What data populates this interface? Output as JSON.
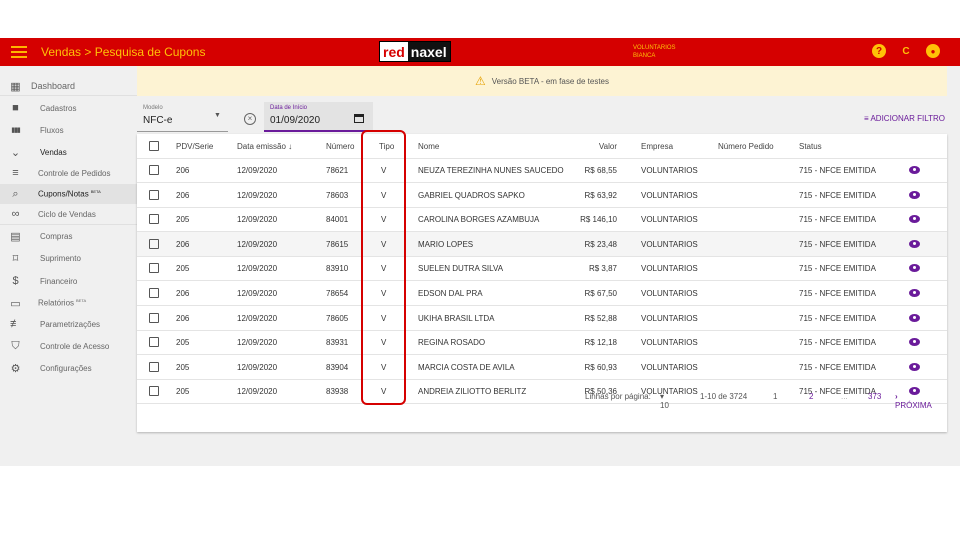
{
  "header": {
    "title": "Vendas > Pesquisa de Cupons",
    "logo_red": "red",
    "logo_dark": "naxel",
    "company_line1": "VOLUNTARIOS",
    "company_line2": "BIANCA",
    "help_icon": "?",
    "refresh_icon": "C",
    "user_icon": "●",
    "colors": {
      "bar": "#d50000",
      "accent": "#ffc107",
      "primary": "#6a1b9a"
    }
  },
  "sidebar": {
    "items": [
      {
        "label": "Dashboard",
        "icon": "dashboard-icon",
        "glyph": "▦"
      },
      {
        "label": "Cadastros",
        "icon": "folder-icon",
        "glyph": "■"
      },
      {
        "label": "Fluxos",
        "icon": "flow-icon",
        "glyph": "▮▮▮"
      },
      {
        "label": "Vendas",
        "icon": "chevron-down-icon",
        "glyph": "⌄"
      },
      {
        "label": "Controle de Pedidos",
        "icon": "list-icon",
        "glyph": "≡"
      },
      {
        "label": "Cupons/Notas",
        "badge": "BETA",
        "icon": "search-icon",
        "glyph": "⌕"
      },
      {
        "label": "Ciclo de Vendas",
        "icon": "infinity-icon",
        "glyph": "∞"
      },
      {
        "label": "Compras",
        "icon": "building-icon",
        "glyph": "▤"
      },
      {
        "label": "Suprimento",
        "icon": "supply-icon",
        "glyph": "⌑"
      },
      {
        "label": "Financeiro",
        "icon": "money-icon",
        "glyph": "$"
      },
      {
        "label": "Relatórios",
        "badge": "BETA",
        "icon": "print-icon",
        "glyph": "▭"
      },
      {
        "label": "Parametrizações",
        "icon": "sliders-icon",
        "glyph": "≢"
      },
      {
        "label": "Controle de Acesso",
        "icon": "shield-icon",
        "glyph": "⛉"
      },
      {
        "label": "Configurações",
        "icon": "gear-icon",
        "glyph": "⚙"
      }
    ]
  },
  "banner": {
    "text": "Versão BETA - em fase de testes",
    "icon": "warning-icon"
  },
  "filters": {
    "model_label": "Modelo",
    "model_value": "NFC-e",
    "date_label": "Data de Início",
    "date_value": "01/09/2020",
    "add_filter": "ADICIONAR FILTRO"
  },
  "table": {
    "headers": [
      "PDV/Serie",
      "Data emissão ↓",
      "Número",
      "Tipo",
      "Nome",
      "Valor",
      "Empresa",
      "Número Pedido",
      "Status"
    ],
    "rows": [
      {
        "pdv": "206",
        "data": "12/09/2020",
        "numero": "78621",
        "tipo": "V",
        "nome": "NEUZA TEREZINHA NUNES SAUCEDO",
        "valor": "R$ 68,55",
        "empresa": "VOLUNTARIOS",
        "pedido": "",
        "status": "715 - NFCE EMITIDA"
      },
      {
        "pdv": "206",
        "data": "12/09/2020",
        "numero": "78603",
        "tipo": "V",
        "nome": "GABRIEL QUADROS SAPKO",
        "valor": "R$ 63,92",
        "empresa": "VOLUNTARIOS",
        "pedido": "",
        "status": "715 - NFCE EMITIDA"
      },
      {
        "pdv": "205",
        "data": "12/09/2020",
        "numero": "84001",
        "tipo": "V",
        "nome": "CAROLINA BORGES AZAMBUJA",
        "valor": "R$ 146,10",
        "empresa": "VOLUNTARIOS",
        "pedido": "",
        "status": "715 - NFCE EMITIDA"
      },
      {
        "pdv": "206",
        "data": "12/09/2020",
        "numero": "78615",
        "tipo": "V",
        "nome": "MARIO LOPES",
        "valor": "R$ 23,48",
        "empresa": "VOLUNTARIOS",
        "pedido": "",
        "status": "715 - NFCE EMITIDA"
      },
      {
        "pdv": "205",
        "data": "12/09/2020",
        "numero": "83910",
        "tipo": "V",
        "nome": "SUELEN DUTRA SILVA",
        "valor": "R$ 3,87",
        "empresa": "VOLUNTARIOS",
        "pedido": "",
        "status": "715 - NFCE EMITIDA"
      },
      {
        "pdv": "206",
        "data": "12/09/2020",
        "numero": "78654",
        "tipo": "V",
        "nome": "EDSON DAL PRA",
        "valor": "R$ 67,50",
        "empresa": "VOLUNTARIOS",
        "pedido": "",
        "status": "715 - NFCE EMITIDA"
      },
      {
        "pdv": "206",
        "data": "12/09/2020",
        "numero": "78605",
        "tipo": "V",
        "nome": "UKIHA BRASIL LTDA",
        "valor": "R$ 52,88",
        "empresa": "VOLUNTARIOS",
        "pedido": "",
        "status": "715 - NFCE EMITIDA"
      },
      {
        "pdv": "205",
        "data": "12/09/2020",
        "numero": "83931",
        "tipo": "V",
        "nome": "REGINA ROSADO",
        "valor": "R$ 12,18",
        "empresa": "VOLUNTARIOS",
        "pedido": "",
        "status": "715 - NFCE EMITIDA"
      },
      {
        "pdv": "205",
        "data": "12/09/2020",
        "numero": "83904",
        "tipo": "V",
        "nome": "MARCIA COSTA DE AVILA",
        "valor": "R$ 60,93",
        "empresa": "VOLUNTARIOS",
        "pedido": "",
        "status": "715 - NFCE EMITIDA"
      },
      {
        "pdv": "205",
        "data": "12/09/2020",
        "numero": "83938",
        "tipo": "V",
        "nome": "ANDREIA ZILIOTTO BERLITZ",
        "valor": "R$ 50,36",
        "empresa": "VOLUNTARIOS",
        "pedido": "",
        "status": "715 - NFCE EMITIDA"
      }
    ]
  },
  "pagination": {
    "rows_label": "Linhas por página:",
    "rows_value": "10",
    "range": "1-10 de 3724",
    "pages": [
      "1",
      "2",
      "...",
      "373"
    ],
    "next": "PRÓXIMA"
  }
}
